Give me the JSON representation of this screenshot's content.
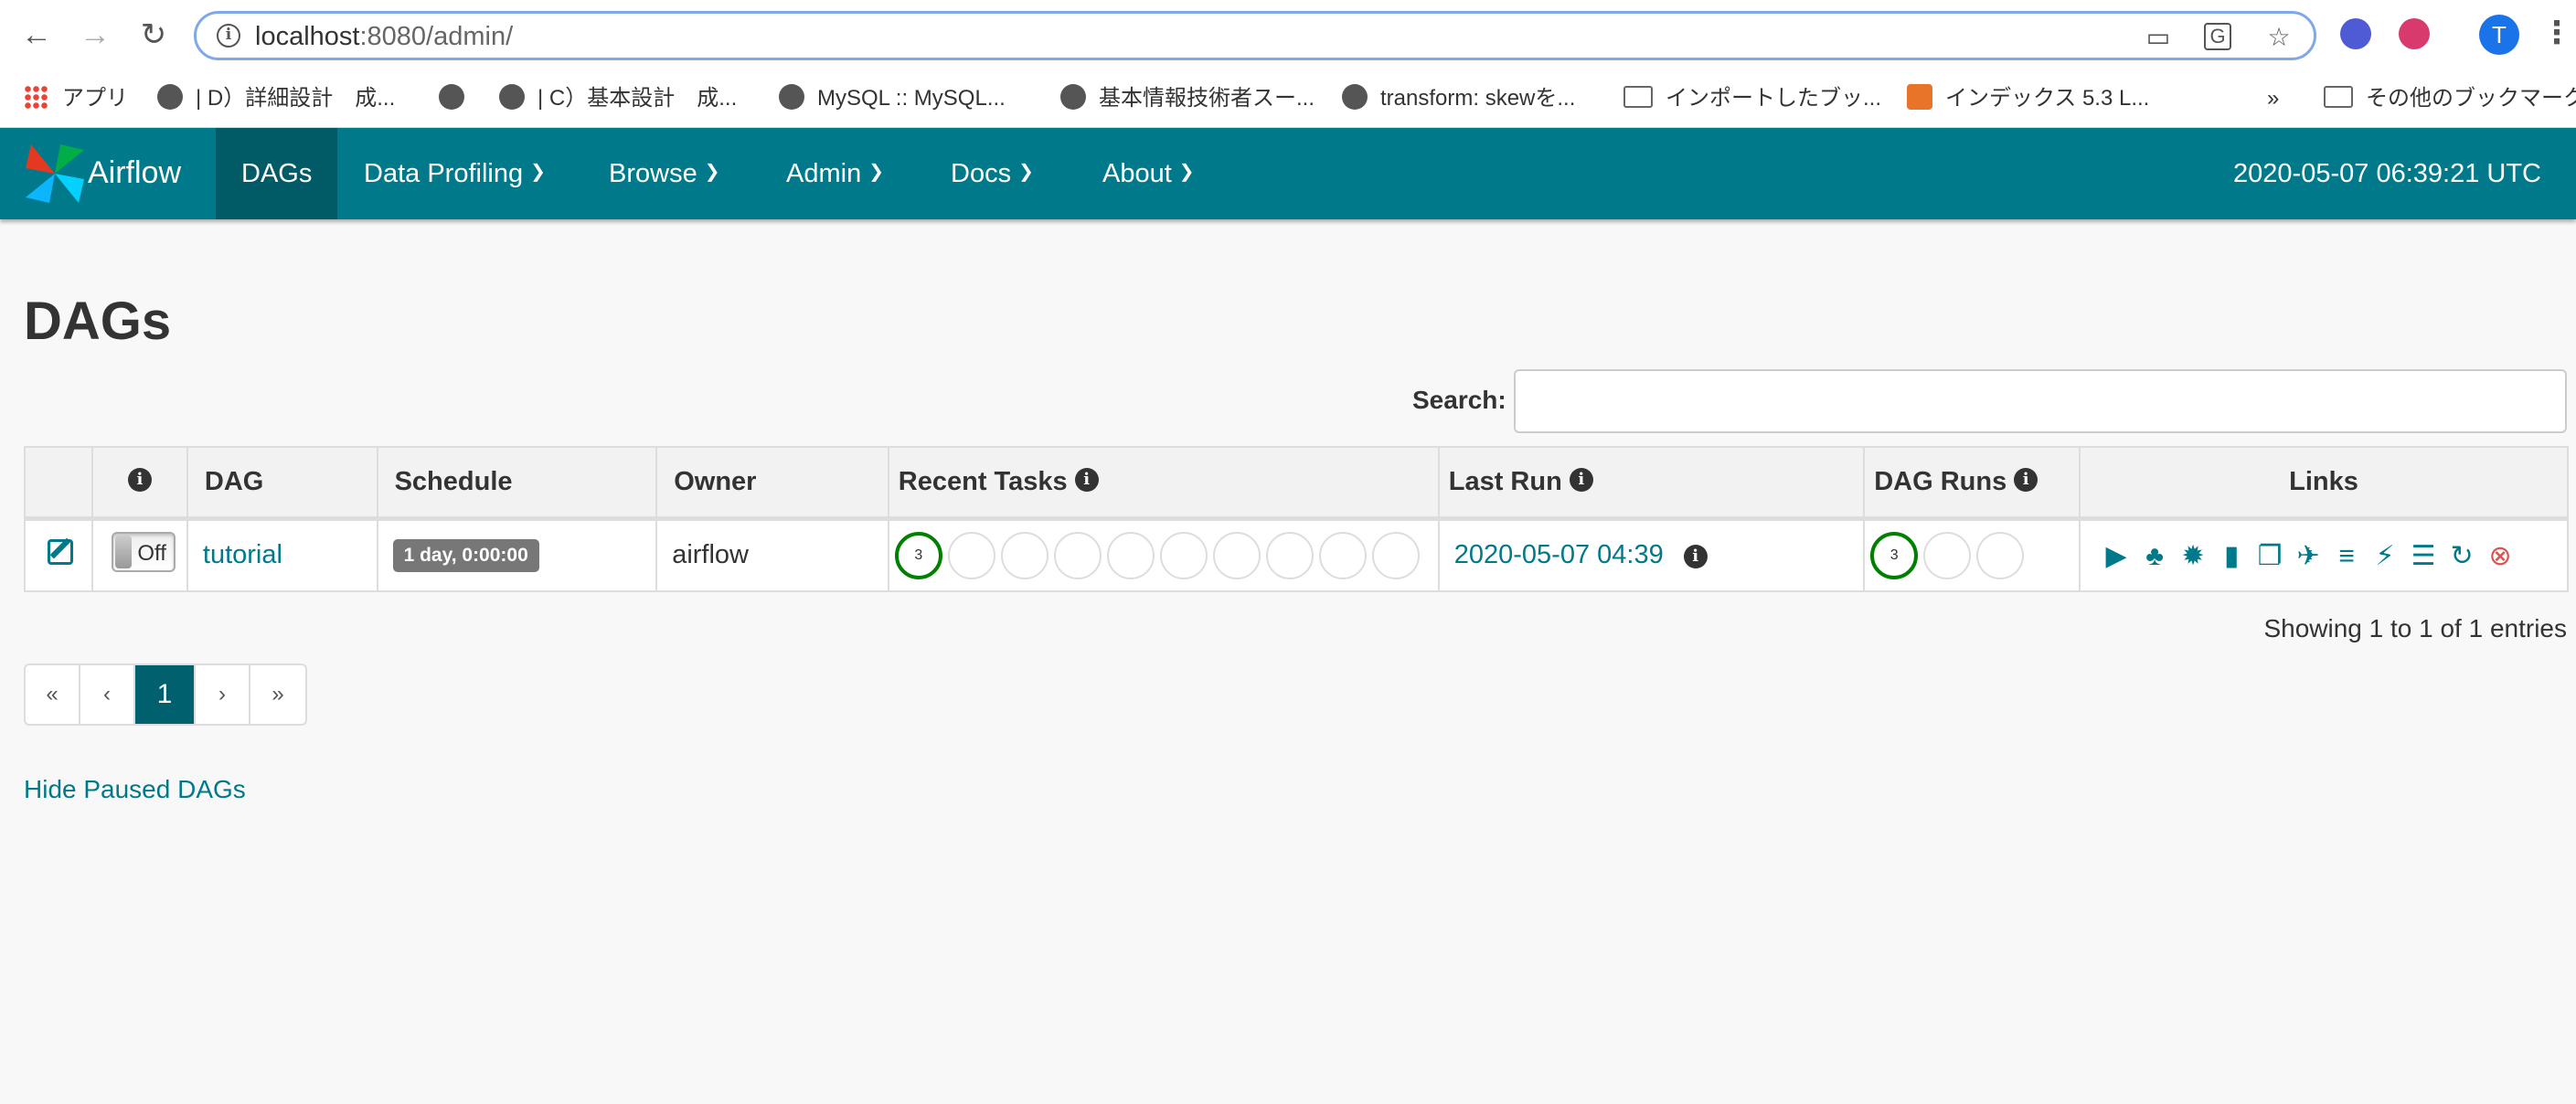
{
  "browser": {
    "url_host": "localhost",
    "url_rest": ":8080/admin/",
    "avatar_letter": "T",
    "bookmarks_overflow": "»"
  },
  "bookmarks": [
    {
      "label": "アプリ",
      "icon": "apps-grid-icon"
    },
    {
      "label": "| D）詳細設計　成...",
      "icon": "globe-icon"
    },
    {
      "label": "",
      "icon": "globe-icon"
    },
    {
      "label": "| C）基本設計　成...",
      "icon": "globe-icon"
    },
    {
      "label": "MySQL :: MySQL...",
      "icon": "globe-icon"
    },
    {
      "label": "基本情報技術者スー...",
      "icon": "globe-icon"
    },
    {
      "label": "transform: skewを...",
      "icon": "globe-icon"
    },
    {
      "label": "インポートしたブッ...",
      "icon": "folder-icon"
    },
    {
      "label": "インデックス 5.3 L...",
      "icon": "favicon-icon"
    },
    {
      "label": "その他のブックマーク",
      "icon": "folder-icon"
    }
  ],
  "navbar": {
    "brand": "Airflow",
    "items": [
      "DAGs",
      "Data Profiling",
      "Browse",
      "Admin",
      "Docs",
      "About"
    ],
    "clock": "2020-05-07 06:39:21 UTC",
    "color": "#00798a"
  },
  "page": {
    "title": "DAGs",
    "search_label": "Search:",
    "search_placeholder": ""
  },
  "table": {
    "headers": {
      "dag": "DAG",
      "schedule": "Schedule",
      "owner": "Owner",
      "recent_tasks": "Recent Tasks",
      "last_run": "Last Run",
      "dag_runs": "DAG Runs",
      "links": "Links"
    },
    "rows": [
      {
        "toggle": "Off",
        "dag": "tutorial",
        "schedule": "1 day, 0:00:00",
        "owner": "airflow",
        "recent_tasks_success": "3",
        "last_run": "2020-05-07 04:39",
        "dag_runs_success": "3"
      }
    ],
    "link_icons": [
      "trigger-dag-icon",
      "tree-view-icon",
      "graph-view-icon",
      "duration-chart-icon",
      "code-icon",
      "task-tries-icon",
      "gantt-icon",
      "landing-times-icon",
      "logs-icon",
      "refresh-icon",
      "delete-icon"
    ]
  },
  "footer": {
    "showing": "Showing 1 to 1 of 1 entries",
    "pager": [
      "«",
      "‹",
      "1",
      "›",
      "»"
    ],
    "hide_paused": "Hide Paused DAGs"
  }
}
